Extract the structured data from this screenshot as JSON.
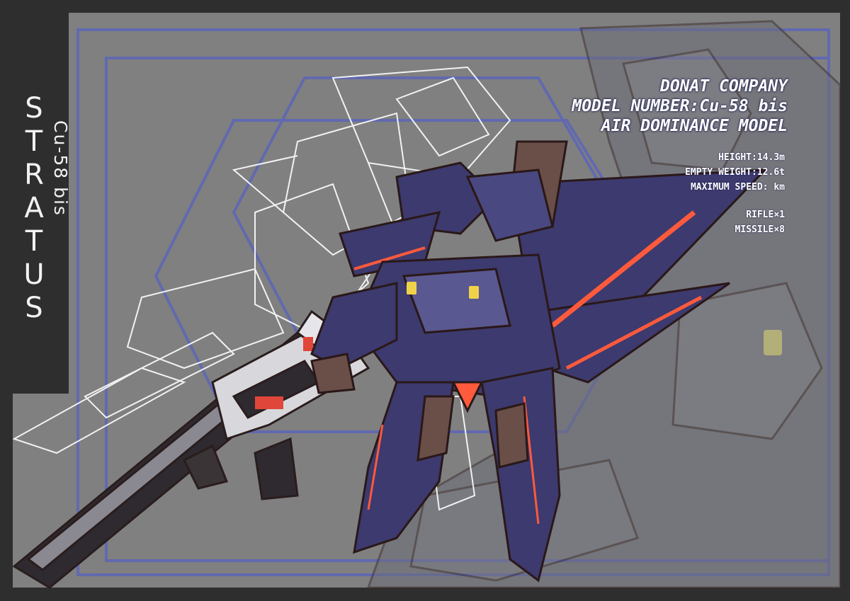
{
  "title": "STRATUS",
  "subtitle": "Cu-58 bis",
  "spec_header": {
    "company": "DONAT COMPANY",
    "model_number": "MODEL NUMBER:Cu-58 bis",
    "model_type": "AIR DOMINANCE MODEL"
  },
  "specs": {
    "height": "HEIGHT:14.3m",
    "empty_weight": "EMPTY WEIGHT:12.6t",
    "maximum_speed": "MAXIMUM SPEED:    km",
    "armament_1": "RIFLE×1",
    "armament_2": "MISSILE×8"
  },
  "colors": {
    "background_gray": "#808080",
    "frame_dark": "#2e2e2e",
    "frame_blue": "#5a64b4",
    "mech_body": "#3c3a6e",
    "mech_accent_red": "#ff5a3c",
    "mech_trim_brown": "#6a4e48"
  }
}
